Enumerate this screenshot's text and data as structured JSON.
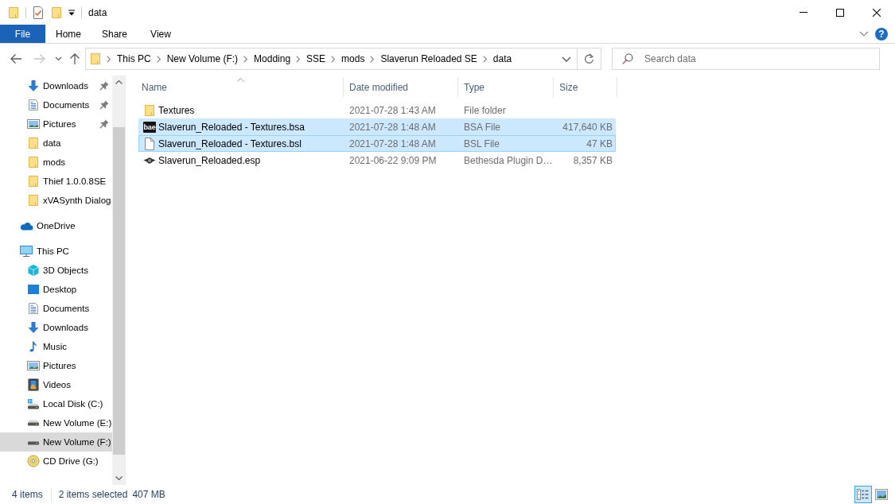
{
  "window": {
    "title": "data"
  },
  "ribbon": {
    "file_tab": "File",
    "tabs": [
      {
        "label": "Home",
        "selected": false
      },
      {
        "label": "Share",
        "selected": false
      },
      {
        "label": "View",
        "selected": false
      }
    ],
    "help": "?"
  },
  "navigation": [
    {
      "kind": "back",
      "disabled": false
    },
    {
      "kind": "forward",
      "disabled": true
    },
    {
      "kind": "recent",
      "disabled": false
    },
    {
      "kind": "up",
      "disabled": false
    }
  ],
  "address_bar": {
    "path": [
      "This PC",
      "New Volume (F:)",
      "Modding",
      "SSE",
      "mods",
      "Slaverun Reloaded SE",
      "data"
    ]
  },
  "search": {
    "placeholder": "Search data"
  },
  "sidebar": {
    "quick_access": [
      {
        "label": "Downloads",
        "kind": "downloads",
        "pinned": true,
        "selected": false
      },
      {
        "label": "Documents",
        "kind": "documents",
        "pinned": true,
        "selected": false
      },
      {
        "label": "Pictures",
        "kind": "pictures",
        "pinned": true,
        "selected": false
      },
      {
        "label": "data",
        "kind": "folder",
        "pinned": false,
        "selected": false
      },
      {
        "label": "mods",
        "kind": "folder",
        "pinned": false,
        "selected": false
      },
      {
        "label": "Thief 1.0.0.8SE",
        "kind": "folder",
        "pinned": false,
        "selected": false
      },
      {
        "label": "xVASynth Dialog",
        "kind": "folder",
        "pinned": false,
        "selected": false
      }
    ],
    "items": [
      {
        "label": "OneDrive",
        "kind": "cloud",
        "selected": false
      },
      {
        "label": "This PC",
        "kind": "computer",
        "selected": false,
        "children": [
          {
            "label": "3D Objects",
            "kind": "cube",
            "selected": false
          },
          {
            "label": "Desktop",
            "kind": "desktop",
            "selected": false
          },
          {
            "label": "Documents",
            "kind": "documents",
            "selected": false
          },
          {
            "label": "Downloads",
            "kind": "downloads",
            "selected": false
          },
          {
            "label": "Music",
            "kind": "music",
            "selected": false
          },
          {
            "label": "Pictures",
            "kind": "pictures",
            "selected": false
          },
          {
            "label": "Videos",
            "kind": "videos",
            "selected": false
          },
          {
            "label": "Local Disk (C:)",
            "kind": "systemdrive",
            "selected": false
          },
          {
            "label": "New Volume (E:)",
            "kind": "drive",
            "selected": false
          },
          {
            "label": "New Volume (F:)",
            "kind": "drive",
            "selected": true
          },
          {
            "label": "CD Drive (G:)",
            "kind": "cddrive",
            "selected": false
          }
        ]
      }
    ]
  },
  "file_list": {
    "columns": [
      {
        "label": "Name",
        "sorted": true
      },
      {
        "label": "Date modified",
        "sorted": false
      },
      {
        "label": "Type",
        "sorted": false
      },
      {
        "label": "Size",
        "sorted": false
      }
    ],
    "rows": [
      {
        "name": "Textures",
        "kind": "folder",
        "date_modified": "2021-07-28 1:43 AM",
        "type": "File folder",
        "selected": false,
        "focused": false
      },
      {
        "name": "Slaverun_Reloaded - Textures.bsa",
        "kind": "archive",
        "icon_label": "bae",
        "date_modified": "2021-07-28 1:48 AM",
        "type": "BSA File",
        "size": "417,640 KB",
        "selected": true,
        "focused": false
      },
      {
        "name": "Slaverun_Reloaded - Textures.bsl",
        "kind": "file",
        "date_modified": "2021-07-28 1:48 AM",
        "type": "BSL File",
        "size": "47 KB",
        "selected": true,
        "focused": true
      },
      {
        "name": "Slaverun_Reloaded.esp",
        "kind": "plugin",
        "date_modified": "2021-06-22 9:09 PM",
        "type": "Bethesda Plugin D…",
        "size": "8,357 KB",
        "selected": false,
        "focused": false
      }
    ]
  },
  "status_bar": {
    "item_count": "4 items",
    "selection": "2 items selected",
    "selection_size": "407 MB"
  },
  "view_buttons": [
    {
      "kind": "details",
      "selected": true
    },
    {
      "kind": "largeicons",
      "selected": false
    }
  ]
}
